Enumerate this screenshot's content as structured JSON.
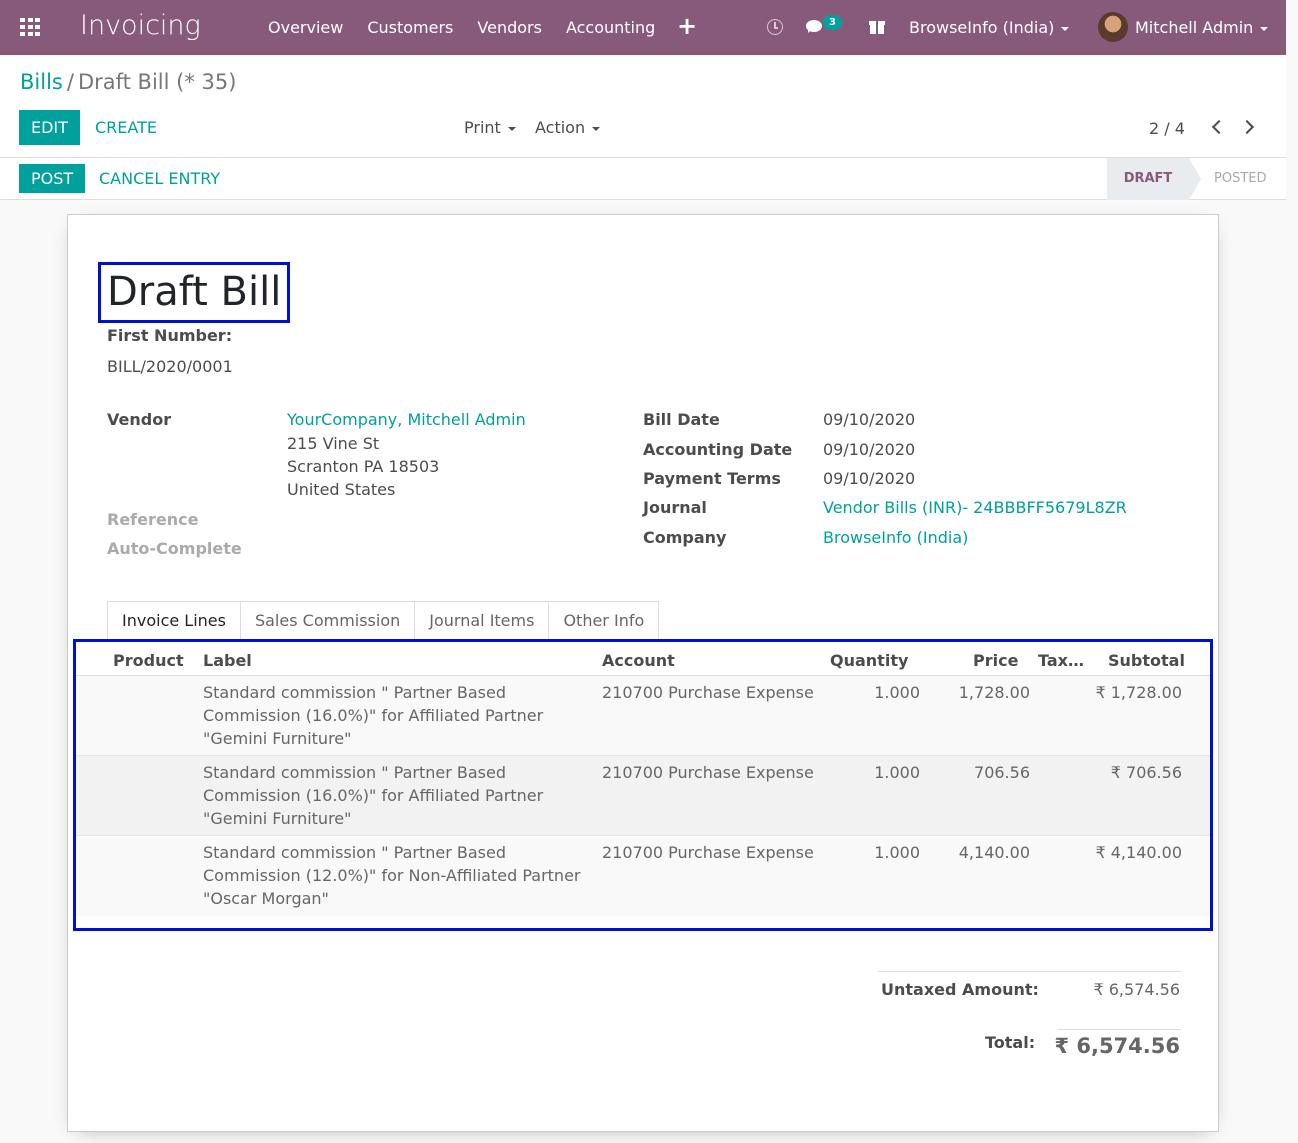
{
  "navbar": {
    "app_name": "Invoicing",
    "menu": [
      "Overview",
      "Customers",
      "Vendors",
      "Accounting"
    ],
    "plus_icon": "+",
    "message_count": "3",
    "company": "BrowseInfo (India)",
    "user": "Mitchell Admin",
    "colors": {
      "bar": "#875a7b",
      "accent": "#00a09d"
    }
  },
  "breadcrumb": {
    "parent": "Bills",
    "separator": "/",
    "current": "Draft Bill (* 35)"
  },
  "buttons": {
    "edit": "EDIT",
    "create": "CREATE",
    "print": "Print",
    "action": "Action",
    "post": "POST",
    "cancel_entry": "CANCEL ENTRY"
  },
  "pager": {
    "value": "2 / 4"
  },
  "status": {
    "draft": "DRAFT",
    "posted": "POSTED",
    "current": "DRAFT"
  },
  "bill": {
    "title": "Draft Bill",
    "first_number_label": "First Number:",
    "first_number": "BILL/2020/0001",
    "vendor_label": "Vendor",
    "vendor_name": "YourCompany, Mitchell Admin",
    "vendor_street": "215 Vine St",
    "vendor_city": "Scranton PA 18503",
    "vendor_country": "United States",
    "reference_label": "Reference",
    "auto_complete_label": "Auto-Complete",
    "bill_date_label": "Bill Date",
    "bill_date": "09/10/2020",
    "accounting_date_label": "Accounting Date",
    "accounting_date": "09/10/2020",
    "payment_terms_label": "Payment Terms",
    "payment_terms": "09/10/2020",
    "journal_label": "Journal",
    "journal": "Vendor Bills (INR)- 24BBBFF5679L8ZR",
    "company_label": "Company",
    "company": "BrowseInfo (India)"
  },
  "tabs": [
    "Invoice Lines",
    "Sales Commission",
    "Journal Items",
    "Other Info"
  ],
  "lines": {
    "headers": {
      "product": "Product",
      "label": "Label",
      "account": "Account",
      "quantity": "Quantity",
      "price": "Price",
      "taxes": "Tax…",
      "subtotal": "Subtotal"
    },
    "rows": [
      {
        "label": "Standard commission \" Partner Based Commission (16.0%)\" for Affiliated Partner \"Gemini Furniture\"",
        "account": "210700 Purchase Expense",
        "quantity": "1.000",
        "price": "1,728.00",
        "subtotal": "₹ 1,728.00"
      },
      {
        "label": "Standard commission \" Partner Based Commission (16.0%)\" for Affiliated Partner \"Gemini Furniture\"",
        "account": "210700 Purchase Expense",
        "quantity": "1.000",
        "price": "706.56",
        "subtotal": "₹ 706.56"
      },
      {
        "label": "Standard commission \" Partner Based Commission (12.0%)\" for Non-Affiliated Partner \"Oscar Morgan\"",
        "account": "210700 Purchase Expense",
        "quantity": "1.000",
        "price": "4,140.00",
        "subtotal": "₹ 4,140.00"
      }
    ]
  },
  "totals": {
    "untaxed_label": "Untaxed Amount:",
    "untaxed": "₹ 6,574.56",
    "total_label": "Total:",
    "total": "₹ 6,574.56"
  }
}
